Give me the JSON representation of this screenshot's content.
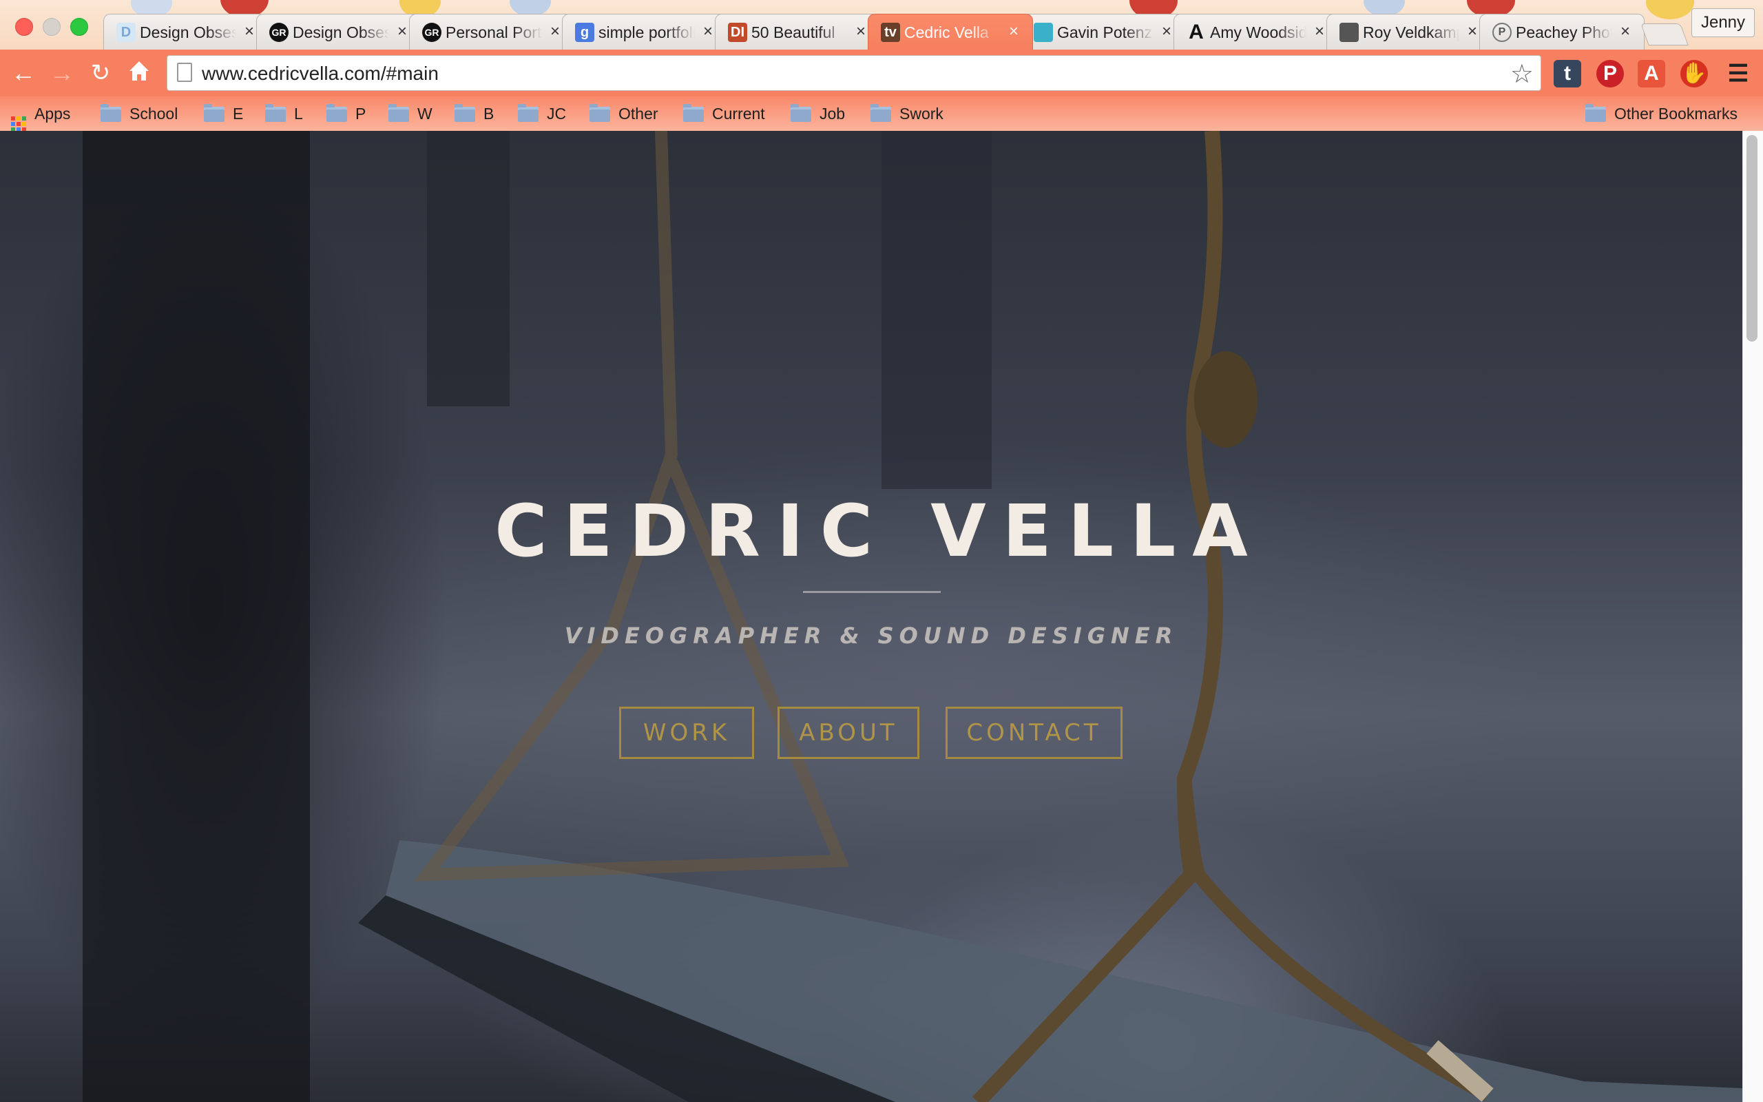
{
  "browser": {
    "profile_name": "Jenny",
    "tabs": [
      {
        "title": "Design Obsession",
        "favicon": "D",
        "favicon_color": "#d5e7f5",
        "active": false
      },
      {
        "title": "Design Obsession",
        "favicon": "GR",
        "favicon_color": "#111111",
        "active": false
      },
      {
        "title": "Personal Portfolio",
        "favicon": "GR",
        "favicon_color": "#111111",
        "active": false
      },
      {
        "title": "simple portfolio",
        "favicon": "g",
        "favicon_color": "#4b7be0",
        "active": false
      },
      {
        "title": "50 Beautiful",
        "favicon": "DI",
        "favicon_color": "#c04a2a",
        "active": false
      },
      {
        "title": "Cedric Vella",
        "favicon": "tv",
        "favicon_color": "#6a3f2a",
        "active": true
      },
      {
        "title": "Gavin Potenza",
        "favicon": "pencil",
        "favicon_color": "#3bb0c9",
        "active": false
      },
      {
        "title": "Amy Woodside",
        "favicon": "A",
        "favicon_color": "#111111",
        "active": false
      },
      {
        "title": "Roy Veldkamp",
        "favicon": "swirl",
        "favicon_color": "#555555",
        "active": false
      },
      {
        "title": "Peachey Photography",
        "favicon": "P",
        "favicon_color": "#666666",
        "active": false
      }
    ],
    "close_glyph": "×",
    "url": "www.cedricvella.com/#main",
    "bookmarks": [
      "Apps",
      "School",
      "E",
      "L",
      "P",
      "W",
      "B",
      "JC",
      "Other",
      "Current",
      "Job",
      "Swork"
    ],
    "other_bookmarks": "Other Bookmarks",
    "toolbar_icons": [
      "back-icon",
      "forward-icon",
      "reload-icon",
      "home-icon",
      "star-icon",
      "tumblr-icon",
      "pinterest-icon",
      "pdf-icon",
      "adblock-icon",
      "menu-icon"
    ],
    "accent_color": "#f6805f"
  },
  "page": {
    "name": "CEDRIC VELLA",
    "role": "VIDEOGRAPHER & SOUND DESIGNER",
    "nav": [
      "WORK",
      "ABOUT",
      "CONTACT"
    ],
    "button_color": "#a68a3e"
  }
}
